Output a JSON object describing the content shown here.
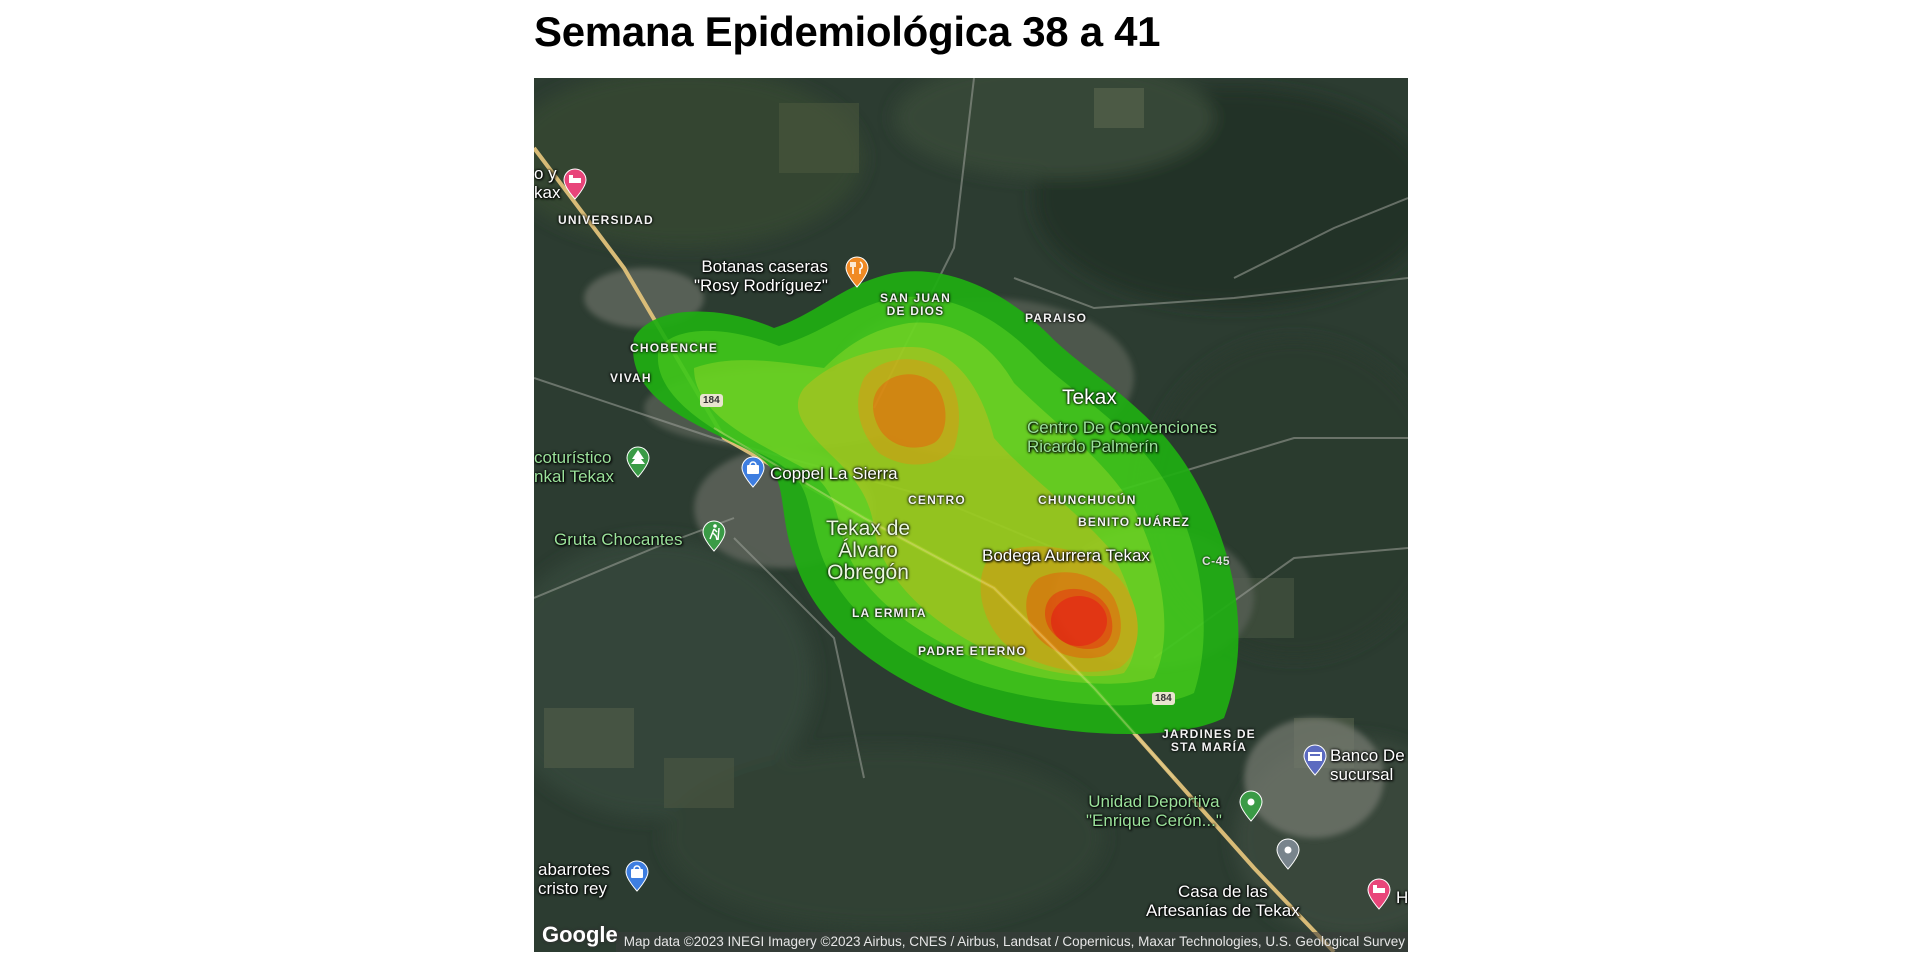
{
  "title": "Semana Epidemiológica 38 a 41",
  "map": {
    "provider_logo": "Google",
    "attribution": "Map data ©2023 INEGI Imagery ©2023 Airbus, CNES / Airbus, Landsat / Copernicus, Maxar Technologies, U.S. Geological Survey",
    "city_label": "Tekax",
    "town_label": "Tekax de\nÁlvaro\nObregón",
    "neighborhoods": {
      "universidad": "UNIVERSIDAD",
      "san_juan": "SAN JUAN\nDE DIOS",
      "paraiso": "PARAISO",
      "chobenche": "CHOBENCHE",
      "vivah": "VIVAH",
      "centro": "CENTRO",
      "chunchucun": "CHUNCHUCÚN",
      "benito_juarez": "BENITO JUÁREZ",
      "la_ermita": "LA ERMITA",
      "padre_eterno": "PADRE ETERNO",
      "jardines": "JARDINES DE\nSTA MARÍA"
    },
    "roads": {
      "shield_184_a": "184",
      "shield_184_b": "184",
      "road_c45": "C-45"
    },
    "pois": {
      "hotel_left": "o y\nkax",
      "botanas": "Botanas caseras\n\"Rosy Rodríguez\"",
      "centro_convenciones": "Centro De Convenciones\nRicardo Palmerín",
      "ecoturistico": "coturístico\nnkal Tekax",
      "coppel": "Coppel La Sierra",
      "gruta": "Gruta Chocantes",
      "bodega": "Bodega Aurrera Tekax",
      "banco": "Banco De\nsucursal",
      "unidad_deportiva": "Unidad Deportiva\n\"Enrique Cerón...\"",
      "abarrotes": "abarrotes\ncristo rey",
      "casa_artesanias": "Casa de las\nArtesanías de Tekax",
      "hotel_right": "H"
    },
    "icons": {
      "hotel": "hotel-bed-icon",
      "restaurant": "restaurant-fork-knife-icon",
      "park": "tree-park-icon",
      "shopping": "shopping-bag-icon",
      "hiking": "hiking-icon",
      "bank": "bank-icon",
      "sports": "sports-venue-icon",
      "landmark": "landmark-pin-icon"
    },
    "heatmap": {
      "palette": [
        "#1fae12",
        "#3fc81a",
        "#6ad720",
        "#9ccf1e",
        "#c4b516",
        "#dc8a0e",
        "#e85a0c",
        "#ee3410"
      ],
      "hotspots": [
        "primary: south-east of centro near Bodega Aurrera",
        "secondary: San Juan de Dios / north of centro"
      ]
    },
    "colors": {
      "satellite_base": "#2c3c31",
      "road": "#e2c27a",
      "hotel_pin": "#e8457a",
      "restaurant_pin": "#f08a24",
      "park_pin": "#3a9b46",
      "shopping_pin": "#3e7ee0",
      "bank_pin": "#5c6bc0",
      "landmark_pin": "#78848c"
    }
  }
}
